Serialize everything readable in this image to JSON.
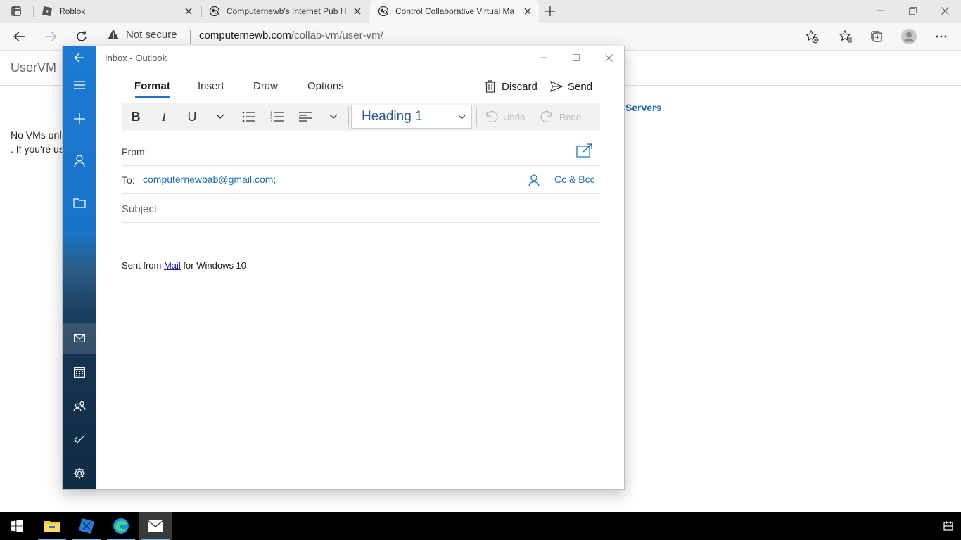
{
  "browser": {
    "tabs": [
      {
        "title": "Roblox",
        "active": false
      },
      {
        "title": "Computernewb's Internet Pub H",
        "active": false
      },
      {
        "title": "Control Collaborative Virtual Ma",
        "active": true
      }
    ],
    "security_label": "Not secure",
    "url_host": "computernewb.com",
    "url_path": "/collab-vm/user-vm/"
  },
  "page": {
    "brand": "UserVM",
    "servers_link": "Servers",
    "message_line1": "No VMs onl",
    "message_line2": ". If you're us"
  },
  "mail": {
    "window_title": "Inbox - Outlook",
    "ribbon": {
      "tabs": [
        "Format",
        "Insert",
        "Draw",
        "Options"
      ],
      "active_tab": "Format",
      "discard_label": "Discard",
      "send_label": "Send"
    },
    "format": {
      "bold": "B",
      "italic": "I",
      "underline": "U",
      "style_value": "Heading 1",
      "undo_label": "Undo",
      "redo_label": "Redo"
    },
    "from_label": "From:",
    "to_label": "To:",
    "to_value": "computernewbab@gmail.com;",
    "cc_bcc_label": "Cc & Bcc",
    "subject_placeholder": "Subject",
    "signature_prefix": "Sent from ",
    "signature_link": "Mail",
    "signature_suffix": " for Windows 10"
  },
  "colors": {
    "mail_accent": "#1a73c8",
    "link_blue": "#1a6fb2",
    "rail_top": "#1d7ad1",
    "rail_bottom": "#0f2b45",
    "taskbar": "#000000"
  },
  "icons": {
    "rail": [
      "back-arrow-icon",
      "hamburger-icon",
      "new-mail-plus-icon",
      "account-person-icon",
      "folder-icon",
      "mail-icon",
      "calendar-icon",
      "people-icon",
      "todo-check-icon",
      "settings-gear-icon"
    ],
    "taskbar": [
      "windows-start-icon",
      "file-explorer-icon",
      "roblox-studio-icon",
      "edge-icon",
      "mail-icon"
    ]
  }
}
